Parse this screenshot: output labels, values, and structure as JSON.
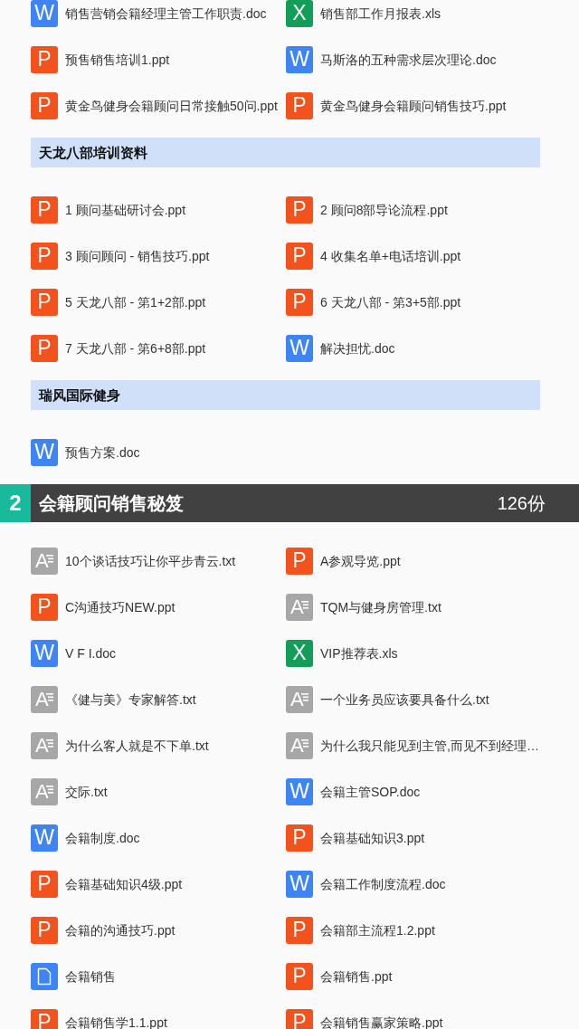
{
  "sections": [
    {
      "groups": [
        {
          "files": [
            {
              "name": "销售营销会籍经理主管工作职责.doc",
              "kind": "doc",
              "letter": "W"
            },
            {
              "name": "销售部工作月报表.xls",
              "kind": "xls",
              "letter": "X"
            },
            {
              "name": "预售销售培训1.ppt",
              "kind": "ppt",
              "letter": "P"
            },
            {
              "name": "马斯洛的五种需求层次理论.doc",
              "kind": "doc",
              "letter": "W"
            },
            {
              "name": "黄金鸟健身会籍顾问日常接触50问.ppt",
              "kind": "ppt",
              "letter": "P"
            },
            {
              "name": "黄金鸟健身会籍顾问销售技巧.ppt",
              "kind": "ppt",
              "letter": "P"
            }
          ]
        },
        {
          "title": "天龙八部培训资料",
          "files": [
            {
              "name": "1 顾问基础研讨会.ppt",
              "kind": "ppt",
              "letter": "P"
            },
            {
              "name": "2 顾问8部导论流程.ppt",
              "kind": "ppt",
              "letter": "P"
            },
            {
              "name": "3 顾问顾问 - 销售技巧.ppt",
              "kind": "ppt",
              "letter": "P"
            },
            {
              "name": "4 收集名单+电话培训.ppt",
              "kind": "ppt",
              "letter": "P"
            },
            {
              "name": "5 天龙八部 - 第1+2部.ppt",
              "kind": "ppt",
              "letter": "P"
            },
            {
              "name": "6 天龙八部 - 第3+5部.ppt",
              "kind": "ppt",
              "letter": "P"
            },
            {
              "name": "7 天龙八部 - 第6+8部.ppt",
              "kind": "ppt",
              "letter": "P"
            },
            {
              "name": "解决担忧.doc",
              "kind": "doc",
              "letter": "W"
            }
          ]
        },
        {
          "title": "瑞风国际健身",
          "files": [
            {
              "name": "预售方案.doc",
              "kind": "doc",
              "letter": "W"
            }
          ]
        }
      ]
    },
    {
      "number": "2",
      "title": "会籍顾问销售秘笈",
      "count": "126份",
      "groups": [
        {
          "files": [
            {
              "name": "10个谈话技巧让你平步青云.txt",
              "kind": "txt",
              "letter": "A"
            },
            {
              "name": "A参观导览.ppt",
              "kind": "ppt",
              "letter": "P"
            },
            {
              "name": "C沟通技巧NEW.ppt",
              "kind": "ppt",
              "letter": "P"
            },
            {
              "name": "TQM与健身房管理.txt",
              "kind": "txt",
              "letter": "A"
            },
            {
              "name": "V F I.doc",
              "kind": "doc",
              "letter": "W"
            },
            {
              "name": "VIP推荐表.xls",
              "kind": "xls",
              "letter": "X"
            },
            {
              "name": "《健与美》专家解答.txt",
              "kind": "txt",
              "letter": "A"
            },
            {
              "name": "一个业务员应该要具备什么.txt",
              "kind": "txt",
              "letter": "A"
            },
            {
              "name": "为什么客人就是不下单.txt",
              "kind": "txt",
              "letter": "A"
            },
            {
              "name": "为什么我只能见到主管,而见不到经理…",
              "kind": "txt",
              "letter": "A"
            },
            {
              "name": "交际.txt",
              "kind": "txt",
              "letter": "A"
            },
            {
              "name": "会籍主管SOP.doc",
              "kind": "doc",
              "letter": "W"
            },
            {
              "name": "会籍制度.doc",
              "kind": "doc",
              "letter": "W"
            },
            {
              "name": "会籍基础知识3.ppt",
              "kind": "ppt",
              "letter": "P"
            },
            {
              "name": "会籍基础知识4级.ppt",
              "kind": "ppt",
              "letter": "P"
            },
            {
              "name": "会籍工作制度流程.doc",
              "kind": "doc",
              "letter": "W"
            },
            {
              "name": "会籍的沟通技巧.ppt",
              "kind": "ppt",
              "letter": "P"
            },
            {
              "name": "会籍部主流程1.2.ppt",
              "kind": "ppt",
              "letter": "P"
            },
            {
              "name": "会籍销售",
              "kind": "file"
            },
            {
              "name": "会籍销售.ppt",
              "kind": "ppt",
              "letter": "P"
            },
            {
              "name": "会籍销售学1.1.ppt",
              "kind": "ppt",
              "letter": "P"
            },
            {
              "name": "会籍销售赢家策略.ppt",
              "kind": "ppt",
              "letter": "P"
            }
          ]
        }
      ]
    }
  ]
}
